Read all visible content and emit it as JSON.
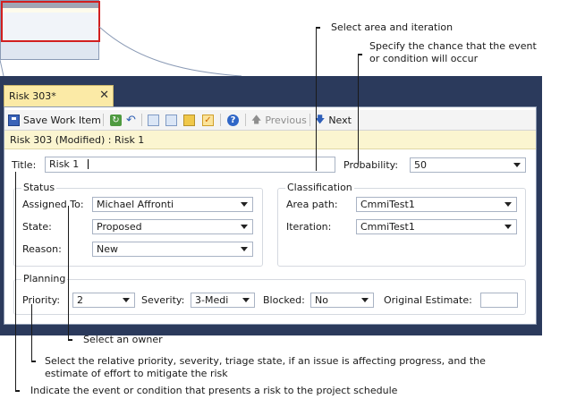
{
  "tab": {
    "title": "Risk 303*",
    "close": "✕"
  },
  "toolbar": {
    "save_label": "Save Work Item",
    "previous_label": "Previous",
    "next_label": "Next"
  },
  "infobar": {
    "text": "Risk 303 (Modified) : Risk 1"
  },
  "form": {
    "title_label": "Title:",
    "title_value": "Risk 1",
    "probability_label": "Probability:",
    "probability_value": "50",
    "status": {
      "heading": "Status",
      "assigned_to_label": "Assigned To:",
      "assigned_to_value": "Michael Affronti",
      "state_label": "State:",
      "state_value": "Proposed",
      "reason_label": "Reason:",
      "reason_value": "New"
    },
    "classification": {
      "heading": "Classification",
      "area_path_label": "Area path:",
      "area_path_value": "CmmiTest1",
      "iteration_label": "Iteration:",
      "iteration_value": "CmmiTest1"
    },
    "planning": {
      "heading": "Planning",
      "priority_label": "Priority:",
      "priority_value": "2",
      "severity_label": "Severity:",
      "severity_value": "3-Medi",
      "blocked_label": "Blocked:",
      "blocked_value": "No",
      "original_estimate_label": "Original Estimate:",
      "original_estimate_value": ""
    }
  },
  "callouts": {
    "area_iteration": "Select area and iteration",
    "probability_line1": "Specify the chance that the event",
    "probability_line2": "or condition will occur",
    "owner": "Select an owner",
    "planning_line1": "Select the relative priority, severity,  triage state, if an issue is affecting progress, and the",
    "planning_line2": "estimate of effort to mitigate the risk",
    "title": "Indicate the event or condition that presents a risk to the project schedule"
  },
  "colors": {
    "window_frame": "#2b3a5c",
    "tab_active": "#fbeaa6",
    "infobar": "#fbf5d0",
    "highlight_border": "#d21f1f"
  },
  "icons": [
    "save-icon",
    "refresh-icon",
    "undo-icon",
    "new-linked-icon",
    "copy-icon",
    "attach-icon",
    "checklist-icon",
    "help-icon",
    "arrow-up-icon",
    "arrow-down-icon"
  ]
}
